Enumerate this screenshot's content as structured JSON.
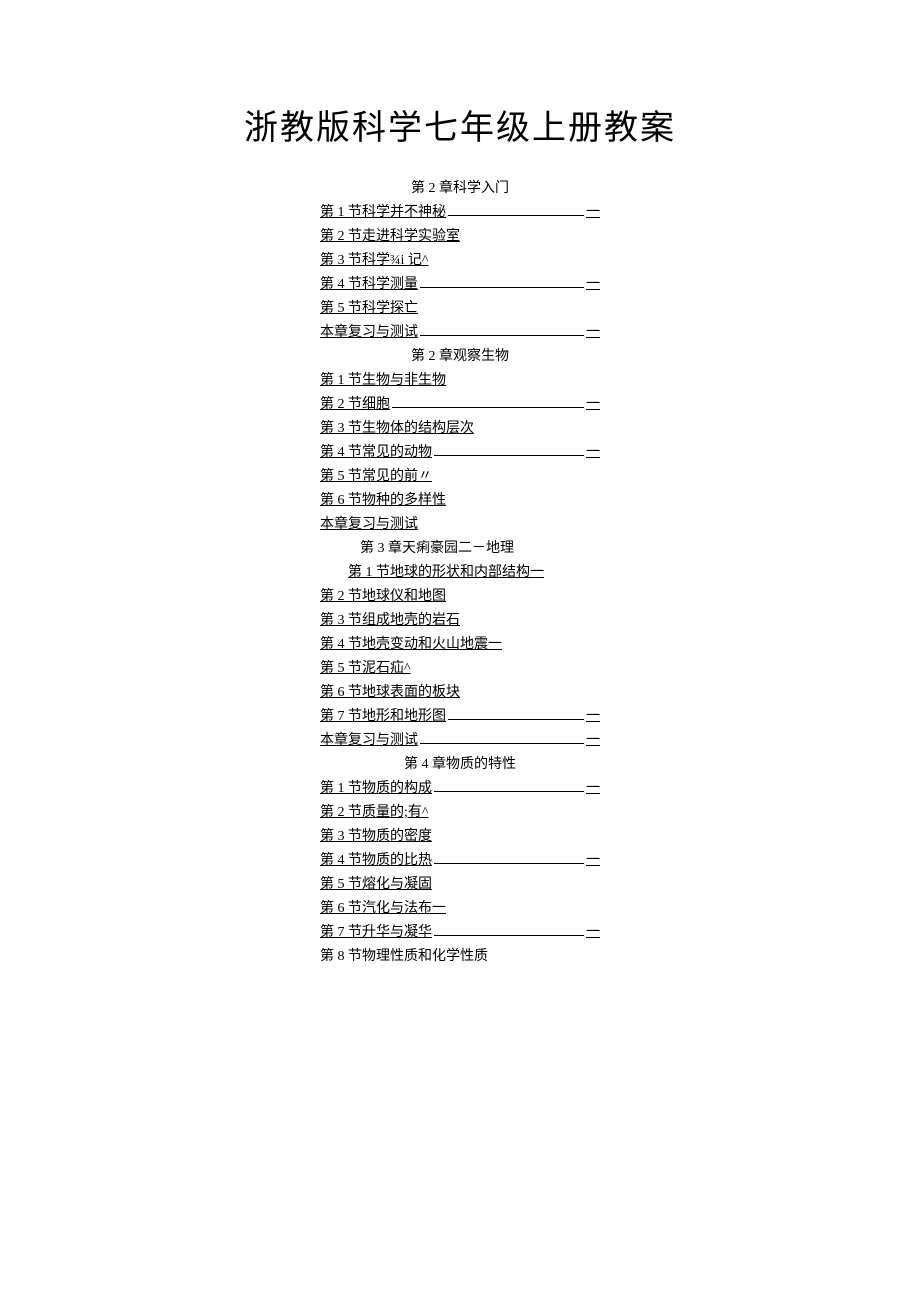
{
  "title": "浙教版科学七年级上册教案",
  "chapters": [
    {
      "heading": "第 2 章科学入门",
      "headingClass": "chapter-heading",
      "items": [
        {
          "label": "第 1 节科学并不神秘",
          "tail": "一",
          "fill": true
        },
        {
          "label": "第 2 节走进科学实验室",
          "fill": false
        },
        {
          "label": "第 3 节科学¾i 记^",
          "fill": false
        },
        {
          "label": "第 4 节科学测量",
          "tail": "一",
          "fill": true
        },
        {
          "label": "第 5 节科学探亡",
          "fill": false
        },
        {
          "label": "本章复习与测试",
          "tail": "一",
          "fill": true
        }
      ]
    },
    {
      "heading": "第 2 章观察生物",
      "headingClass": "chapter-heading",
      "items": [
        {
          "label": "第 1 节生物与非生物",
          "fill": false
        },
        {
          "label": "第 2 节细胞",
          "tail": "一",
          "fill": true
        },
        {
          "label": "第 3 节生物体的结构层次",
          "fill": false
        },
        {
          "label": "第 4 节常见的动物",
          "tail": "一",
          "fill": true
        },
        {
          "label": "第 5 节常见的前〃",
          "fill": false
        },
        {
          "label": "第 6 节物种的多样性",
          "fill": false
        },
        {
          "label": "本章复习与测试",
          "fill": false
        }
      ]
    },
    {
      "heading": "第 3 章天痢豪园二－地理",
      "headingClass": "indent-chapter",
      "items": [
        {
          "label": "第 1 节地球的形状和内部结构一",
          "fill": false,
          "indent": true
        },
        {
          "label": "第 2 节地球仪和地图",
          "fill": false
        },
        {
          "label": "第 3 节组成地壳的岩石",
          "fill": false
        },
        {
          "label": "第 4 节地壳变动和火山地震一",
          "fill": false
        },
        {
          "label": "第 5 节泥石疝^",
          "fill": false
        },
        {
          "label": "第 6 节地球表面的板块",
          "fill": false
        },
        {
          "label": "第 7 节地形和地形图",
          "tail": "一",
          "fill": true
        },
        {
          "label": "本章复习与测试",
          "tail": "一",
          "fill": true
        }
      ]
    },
    {
      "heading": "第 4 章物质的特性",
      "headingClass": "chapter-heading",
      "items": [
        {
          "label": "第 1 节物质的构成",
          "tail": "一",
          "fill": true
        },
        {
          "label": "第 2 节质量的;有^",
          "fill": false
        },
        {
          "label": "第 3 节物质的密度",
          "fill": false
        },
        {
          "label": "第 4 节物质的比热",
          "tail": "一",
          "fill": true
        },
        {
          "label": "第 5 节熔化与凝固",
          "fill": false
        },
        {
          "label": "第 6 节汽化与法布一",
          "fill": false
        },
        {
          "label": "第 7 节升华与凝华",
          "tail": "一",
          "fill": true
        },
        {
          "label": "第 8 节物理性质和化学性质",
          "fill": false,
          "plain": true
        }
      ]
    }
  ]
}
